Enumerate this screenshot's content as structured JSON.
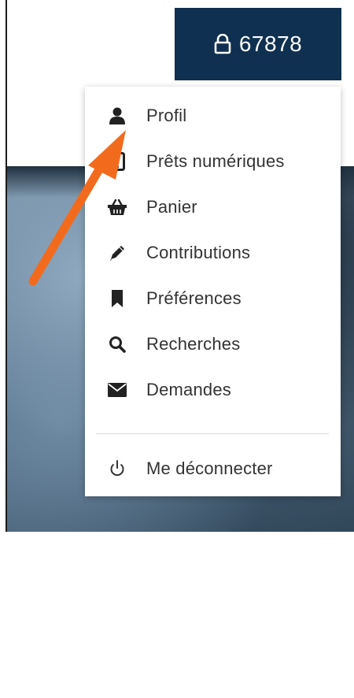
{
  "account": {
    "number": "67878",
    "icon": "lock-icon"
  },
  "menu": {
    "items": [
      {
        "label": "Profil",
        "icon": "user-icon"
      },
      {
        "label": "Prêts numériques",
        "icon": "tablet-icon"
      },
      {
        "label": "Panier",
        "icon": "basket-icon"
      },
      {
        "label": "Contributions",
        "icon": "pencil-icon"
      },
      {
        "label": "Préférences",
        "icon": "bookmark-icon"
      },
      {
        "label": "Recherches",
        "icon": "search-icon"
      },
      {
        "label": "Demandes",
        "icon": "envelope-icon"
      }
    ],
    "logout": {
      "label": "Me déconnecter",
      "icon": "power-icon"
    }
  },
  "colors": {
    "account_bg": "#0f3050",
    "annotation_arrow": "#f26b1d",
    "menu_text": "#333333"
  }
}
